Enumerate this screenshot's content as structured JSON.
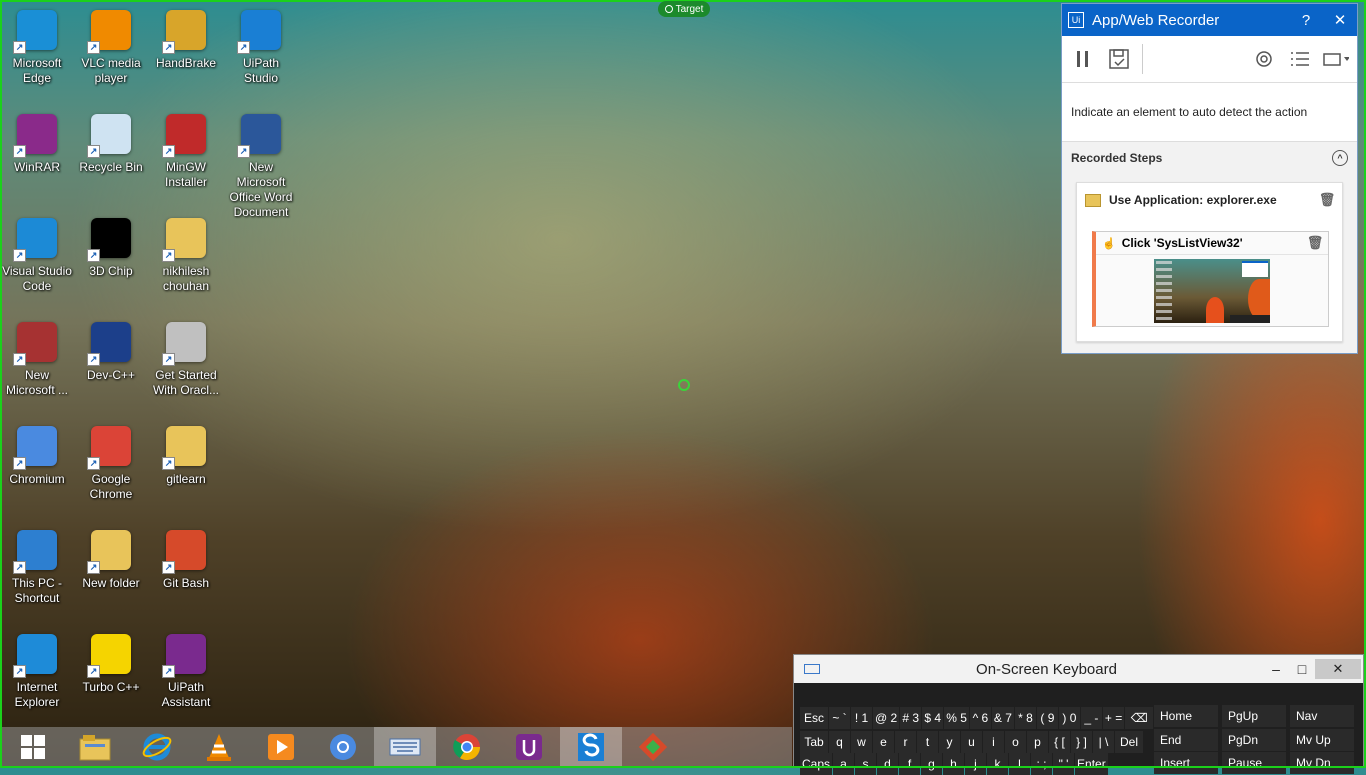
{
  "overlay": {
    "target_label": "Target"
  },
  "desktop_icons": [
    {
      "label": "Microsoft\nEdge",
      "name": "edge-icon",
      "color": "#1a8fd6"
    },
    {
      "label": "VLC media\nplayer",
      "name": "vlc-icon",
      "color": "#f08a00"
    },
    {
      "label": "HandBrake",
      "name": "handbrake-icon",
      "color": "#d8a52a"
    },
    {
      "label": "UiPath\nStudio",
      "name": "uipath-studio-icon",
      "color": "#1a7fd4"
    },
    {
      "label": "WinRAR",
      "name": "winrar-icon",
      "color": "#8a2a8a"
    },
    {
      "label": "Recycle Bin",
      "name": "recycle-bin-icon",
      "color": "#cfe3f2"
    },
    {
      "label": "MinGW\nInstaller",
      "name": "mingw-installer-icon",
      "color": "#c02a2a"
    },
    {
      "label": "New\nMicrosoft\nOffice Word\nDocument",
      "name": "word-document-icon",
      "color": "#2b579a"
    },
    {
      "label": "Visual Studio\nCode",
      "name": "vscode-icon",
      "color": "#1c8ad6"
    },
    {
      "label": "3D Chip",
      "name": "3dp-chip-icon",
      "color": "#000000"
    },
    {
      "label": "nikhilesh\nchouhan",
      "name": "user-folder-icon",
      "color": "#e8c45a"
    },
    {
      "label": "New\nMicrosoft ...",
      "name": "access-database-icon",
      "color": "#a63232"
    },
    {
      "label": "Dev-C++",
      "name": "devcpp-icon",
      "color": "#1c3f8a"
    },
    {
      "label": "Get Started\nWith Oracl...",
      "name": "oracle-icon",
      "color": "#c0c0c0"
    },
    {
      "label": "Chromium",
      "name": "chromium-icon",
      "color": "#4a8ae0"
    },
    {
      "label": "Google\nChrome",
      "name": "chrome-icon",
      "color": "#db4437"
    },
    {
      "label": "gitlearn",
      "name": "gitlearn-folder-icon",
      "color": "#e8c45a"
    },
    {
      "label": "This PC -\nShortcut",
      "name": "this-pc-icon",
      "color": "#2d7fd0"
    },
    {
      "label": "New folder",
      "name": "new-folder-icon",
      "color": "#e8c45a"
    },
    {
      "label": "Git Bash",
      "name": "git-bash-icon",
      "color": "#d64a2a"
    },
    {
      "label": "Internet\nExplorer",
      "name": "internet-explorer-icon",
      "color": "#1e8bd8"
    },
    {
      "label": "Turbo C++",
      "name": "turbo-cpp-icon",
      "color": "#f5d400"
    },
    {
      "label": "UiPath\nAssistant",
      "name": "uipath-assistant-icon",
      "color": "#7a2a8e"
    }
  ],
  "recorder": {
    "title": "App/Web Recorder",
    "help": "?",
    "close": "✕",
    "hint": "Indicate an element to auto detect the action",
    "recorded_steps_label": "Recorded Steps",
    "step": {
      "title": "Use Application: explorer.exe",
      "sub_title": "Click 'SysListView32'"
    }
  },
  "taskbar": {
    "items": [
      "start-button",
      "file-explorer",
      "internet-explorer",
      "vlc",
      "media-player",
      "chromium",
      "on-screen-keyboard",
      "chrome",
      "uipath-assistant",
      "uipath-studio",
      "git-bash"
    ]
  },
  "osk": {
    "title": "On-Screen Keyboard",
    "minimize": "–",
    "maximize": "□",
    "close": "✕",
    "row1": [
      "Esc",
      "~ `",
      "! 1",
      "@ 2",
      "# 3",
      "$ 4",
      "% 5",
      "^ 6",
      "& 7",
      "* 8",
      "( 9",
      ") 0",
      "_ -",
      "+ =",
      "⌫"
    ],
    "row2": [
      "Tab",
      "q",
      "w",
      "e",
      "r",
      "t",
      "y",
      "u",
      "i",
      "o",
      "p",
      "{ [",
      "} ]",
      "| \\",
      "Del"
    ],
    "row3": [
      "Caps",
      "a",
      "s",
      "d",
      "f",
      "g",
      "h",
      "j",
      "k",
      "l",
      ": ;",
      "\" '",
      "Enter"
    ],
    "nav": [
      "Home",
      "PgUp",
      "Nav",
      "End",
      "PgDn",
      "Mv Up",
      "Insert",
      "Pause",
      "Mv Dn"
    ]
  }
}
